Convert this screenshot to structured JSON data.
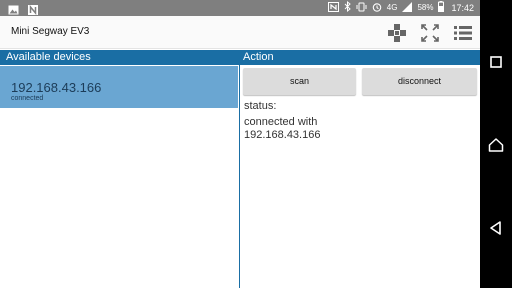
{
  "status_bar": {
    "icons_left": [
      "image-icon",
      "n-icon"
    ],
    "icons_right": [
      "nfc-icon",
      "bluetooth-icon",
      "vibrate-icon",
      "alarm-icon"
    ],
    "network": "4G",
    "battery": "58%",
    "time": "17:42"
  },
  "app": {
    "title": "Mini Segway EV3",
    "actions": [
      "gamepad-icon",
      "fullscreen-icon",
      "list-icon"
    ]
  },
  "devices": {
    "header": "Available devices",
    "items": [
      {
        "ip": "192.168.43.166",
        "status": "connected"
      }
    ]
  },
  "action": {
    "header": "Action",
    "scan_label": "scan",
    "disconnect_label": "disconnect",
    "status_label": "status:",
    "status_text": "connected with\n192.168.43.166"
  },
  "colors": {
    "accent": "#1a6ea4",
    "selected_item": "#6aa6d2",
    "status_bar": "#7f7f7f"
  }
}
